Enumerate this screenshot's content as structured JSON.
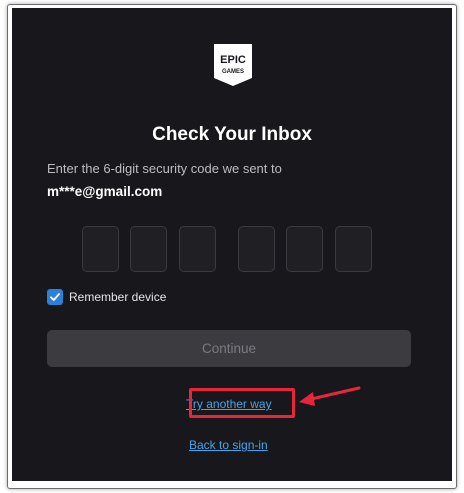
{
  "logo": {
    "line1": "EPIC",
    "line2": "GAMES"
  },
  "title": "Check Your Inbox",
  "subtitle": "Enter the 6-digit security code we sent to",
  "email": "m***e@gmail.com",
  "code_digits": [
    "",
    "",
    "",
    "",
    "",
    ""
  ],
  "remember": {
    "label": "Remember device",
    "checked": true
  },
  "continue_label": "Continue",
  "try_another_way": "Try another way",
  "back_to_signin": "Back to sign-in",
  "colors": {
    "background": "#18181c",
    "accent": "#2d7fd8",
    "link": "#48a3e6",
    "annotation": "#e8253a"
  }
}
